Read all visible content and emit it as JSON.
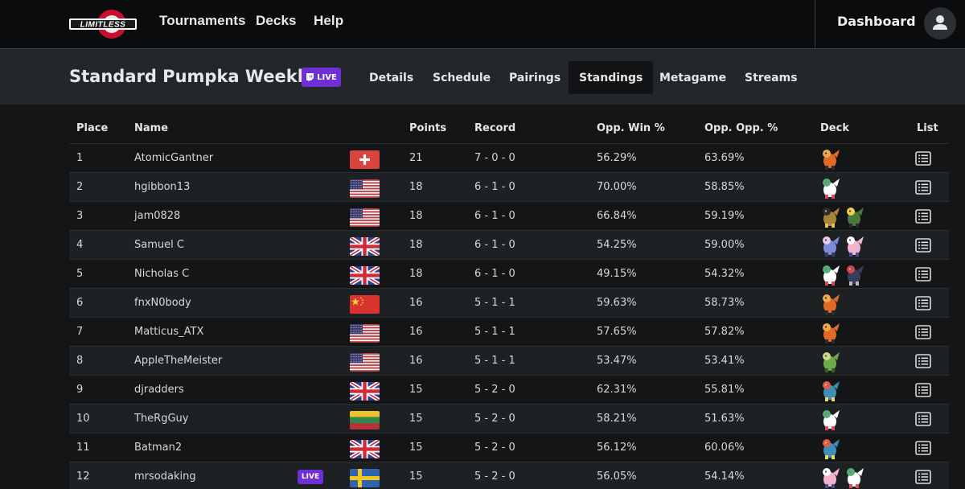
{
  "nav": {
    "logo_text": "LIMITLESS",
    "links": [
      "Tournaments",
      "Decks",
      "Help"
    ],
    "dashboard": "Dashboard"
  },
  "tournament": {
    "title": "Standard Pumpka Weekly",
    "live_badge": "LIVE",
    "tabs": [
      "Details",
      "Schedule",
      "Pairings",
      "Standings",
      "Metagame",
      "Streams"
    ],
    "active_tab": "Standings"
  },
  "table": {
    "headers": [
      "Place",
      "Name",
      "Points",
      "Record",
      "Opp. Win %",
      "Opp. Opp. %",
      "Deck",
      "List"
    ],
    "rows": [
      {
        "place": "1",
        "name": "AtomicGantner",
        "flag": "ch",
        "points": "21",
        "record": "7 - 0 - 0",
        "opp_win": "56.29%",
        "opp_opp": "63.69%",
        "deck": [
          "charizard"
        ],
        "live": ""
      },
      {
        "place": "2",
        "name": "hgibbon13",
        "flag": "us",
        "points": "18",
        "record": "6 - 1 - 0",
        "opp_win": "70.00%",
        "opp_opp": "58.85%",
        "deck": [
          "gardevoir"
        ],
        "live": ""
      },
      {
        "place": "3",
        "name": "jam0828",
        "flag": "us",
        "points": "18",
        "record": "6 - 1 - 0",
        "opp_win": "66.84%",
        "opp_opp": "59.19%",
        "deck": [
          "regidrago",
          "rayquaza"
        ],
        "live": ""
      },
      {
        "place": "4",
        "name": "Samuel C",
        "flag": "gb",
        "points": "18",
        "record": "6 - 1 - 0",
        "opp_win": "54.25%",
        "opp_opp": "59.00%",
        "deck": [
          "palkia",
          "mew"
        ],
        "live": ""
      },
      {
        "place": "5",
        "name": "Nicholas C",
        "flag": "gb",
        "points": "18",
        "record": "6 - 1 - 0",
        "opp_win": "49.15%",
        "opp_opp": "54.32%",
        "deck": [
          "gardevoir",
          "giratina"
        ],
        "live": ""
      },
      {
        "place": "6",
        "name": "fnxN0body",
        "flag": "cn",
        "points": "16",
        "record": "5 - 1 - 1",
        "opp_win": "59.63%",
        "opp_opp": "58.73%",
        "deck": [
          "charizard"
        ],
        "live": ""
      },
      {
        "place": "7",
        "name": "Matticus_ATX",
        "flag": "us",
        "points": "16",
        "record": "5 - 1 - 1",
        "opp_win": "57.65%",
        "opp_opp": "57.82%",
        "deck": [
          "charizard"
        ],
        "live": ""
      },
      {
        "place": "8",
        "name": "AppleTheMeister",
        "flag": "us",
        "points": "16",
        "record": "5 - 1 - 1",
        "opp_win": "53.47%",
        "opp_opp": "53.41%",
        "deck": [
          "dipplin"
        ],
        "live": ""
      },
      {
        "place": "9",
        "name": "djradders",
        "flag": "gb",
        "points": "15",
        "record": "5 - 2 - 0",
        "opp_win": "62.31%",
        "opp_opp": "55.81%",
        "deck": [
          "feraligatr"
        ],
        "live": ""
      },
      {
        "place": "10",
        "name": "TheRgGuy",
        "flag": "lt",
        "points": "15",
        "record": "5 - 2 - 0",
        "opp_win": "58.21%",
        "opp_opp": "51.63%",
        "deck": [
          "gardevoir"
        ],
        "live": ""
      },
      {
        "place": "11",
        "name": "Batman2",
        "flag": "gb",
        "points": "15",
        "record": "5 - 2 - 0",
        "opp_win": "56.12%",
        "opp_opp": "60.06%",
        "deck": [
          "feraligatr"
        ],
        "live": ""
      },
      {
        "place": "12",
        "name": "mrsodaking",
        "flag": "se",
        "points": "15",
        "record": "5 - 2 - 0",
        "opp_win": "56.05%",
        "opp_opp": "54.14%",
        "deck": [
          "mew",
          "gardevoir"
        ],
        "live": "LIVE"
      }
    ]
  },
  "colors": {
    "accent_live": "#6f2fd6",
    "bg": "#131516",
    "header_bg": "#24272a",
    "nav_bg": "#0b0c0d"
  }
}
